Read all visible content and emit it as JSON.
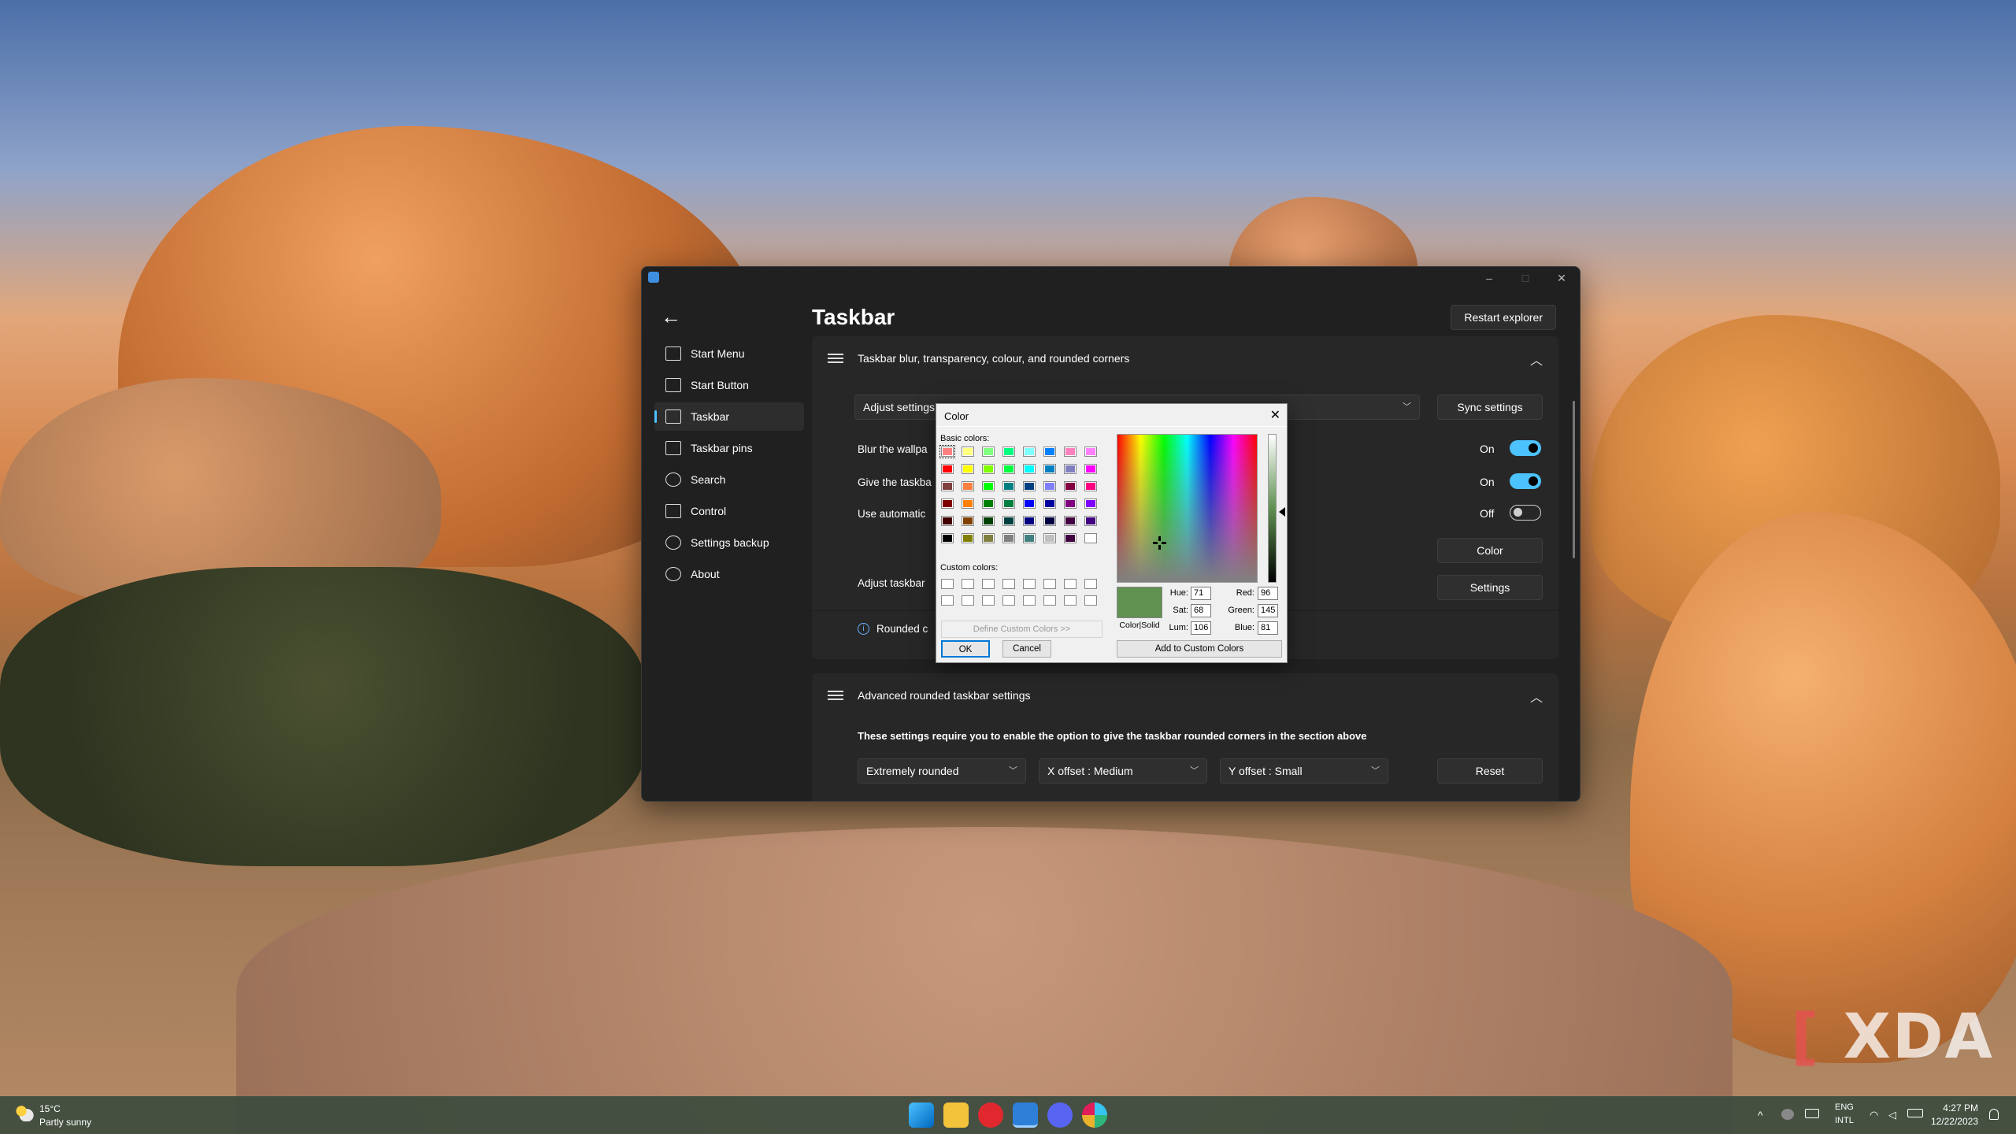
{
  "window": {
    "minimize": "–",
    "maximize": "□",
    "close": "✕",
    "back": "←"
  },
  "sidebar": {
    "items": [
      {
        "label": "Start Menu"
      },
      {
        "label": "Start Button"
      },
      {
        "label": "Taskbar"
      },
      {
        "label": "Taskbar pins"
      },
      {
        "label": "Search"
      },
      {
        "label": "Control"
      },
      {
        "label": "Settings backup"
      },
      {
        "label": "About"
      }
    ]
  },
  "header": {
    "title": "Taskbar",
    "restart_label": "Restart explorer"
  },
  "section1": {
    "title": "Taskbar blur, transparency, colour, and rounded corners",
    "adjust_label": "Adjust settings",
    "sync_label": "Sync settings",
    "row_blur": "Blur the wallpa",
    "row_give": "Give the taskba",
    "row_auto": "Use automatic",
    "toggle_blur": "On",
    "toggle_give": "On",
    "toggle_auto": "Off",
    "color_btn": "Color",
    "adjust_taskbar": "Adjust taskbar",
    "settings_btn": "Settings",
    "rounded_info": "Rounded c",
    "info_icon": "i"
  },
  "section2": {
    "title": "Advanced rounded taskbar settings",
    "note": "These settings require you to enable the option to give the taskbar rounded corners in the section above",
    "dd_rounding": "Extremely rounded",
    "dd_x": "X offset : Medium",
    "dd_y": "Y offset : Small",
    "reset": "Reset"
  },
  "color_dialog": {
    "title": "Color",
    "close": "✕",
    "basic_label": "Basic colors:",
    "custom_label": "Custom colors:",
    "define_label": "Define Custom Colors >>",
    "ok": "OK",
    "cancel": "Cancel",
    "add_custom": "Add to Custom Colors",
    "solid_label": "Color|Solid",
    "hue_label": "Hue:",
    "hue": "71",
    "sat_label": "Sat:",
    "sat": "68",
    "lum_label": "Lum:",
    "lum": "106",
    "red_label": "Red:",
    "red": "96",
    "green_label": "Green:",
    "green": "145",
    "blue_label": "Blue:",
    "blue": "81",
    "selected_color": "#609151",
    "basic_colors": [
      "#ff8080",
      "#ffff80",
      "#80ff80",
      "#00ff80",
      "#80ffff",
      "#0080ff",
      "#ff80c0",
      "#ff80ff",
      "#ff0000",
      "#ffff00",
      "#80ff00",
      "#00ff40",
      "#00ffff",
      "#0080c0",
      "#8080c0",
      "#ff00ff",
      "#804040",
      "#ff8040",
      "#00ff00",
      "#008080",
      "#004080",
      "#8080ff",
      "#800040",
      "#ff0080",
      "#800000",
      "#ff8000",
      "#008000",
      "#008040",
      "#0000ff",
      "#0000a0",
      "#800080",
      "#8000ff",
      "#400000",
      "#804000",
      "#004000",
      "#004040",
      "#000080",
      "#000040",
      "#400040",
      "#400080",
      "#000000",
      "#808000",
      "#808040",
      "#808080",
      "#408080",
      "#c0c0c0",
      "#400040",
      "#ffffff"
    ]
  },
  "taskbar": {
    "temp": "15°C",
    "weather": "Partly sunny",
    "lang_top": "ENG",
    "lang_bottom": "INTL",
    "time": "4:27 PM",
    "date": "12/22/2023",
    "tray_chevron": "^"
  },
  "watermark": {
    "brand": "XDA"
  }
}
